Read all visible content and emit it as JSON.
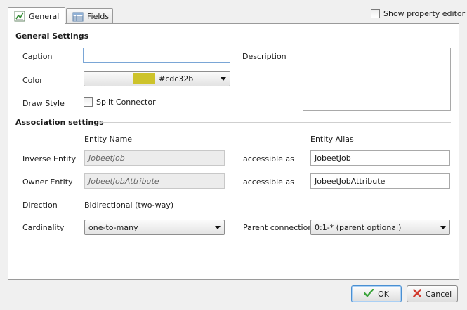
{
  "tabs": [
    {
      "label": "General",
      "icon": "chart-edit-icon"
    },
    {
      "label": "Fields",
      "icon": "table-icon"
    }
  ],
  "show_property_editor": {
    "label": "Show property editor",
    "checked": false
  },
  "general": {
    "title": "General Settings",
    "caption_label": "Caption",
    "caption_value": "",
    "description_label": "Description",
    "color_label": "Color",
    "color_value": "#cdc32b",
    "color_swatch": "#cdc32b",
    "draw_style_label": "Draw Style",
    "split_connector_label": "Split Connector",
    "split_connector_checked": false
  },
  "association": {
    "title": "Association settings",
    "entity_name_header": "Entity Name",
    "entity_alias_header": "Entity Alias",
    "inverse_label": "Inverse Entity",
    "inverse_entity": "JobeetJob",
    "inverse_accessible": "accessible as",
    "inverse_alias": "JobeetJob",
    "owner_label": "Owner Entity",
    "owner_entity": "JobeetJobAttribute",
    "owner_accessible": "accessible as",
    "owner_alias": "JobeetJobAttribute",
    "direction_label": "Direction",
    "direction_value": "Bidirectional (two-way)",
    "cardinality_label": "Cardinality",
    "cardinality_value": "one-to-many",
    "parent_connection_label": "Parent connection",
    "parent_connection_value": "0:1-* (parent optional)"
  },
  "buttons": {
    "ok": "OK",
    "cancel": "Cancel"
  },
  "colors": {
    "accent": "#4a8fd1",
    "ok_check": "#3aa33a",
    "cancel_x": "#d23b2f"
  }
}
